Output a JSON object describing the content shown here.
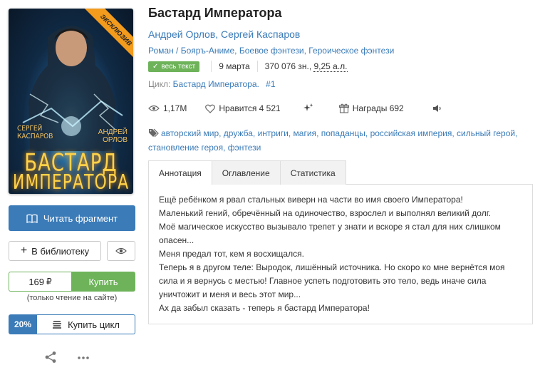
{
  "cover": {
    "ribbon": "ЭКСКЛЮЗИВ",
    "author_left": [
      "СЕРГЕЙ",
      "КАСПАРОВ"
    ],
    "author_right": [
      "АНДРЕЙ",
      "ОРЛОВ"
    ],
    "title_line1": "БАСТАРД",
    "title_line2": "ИМПЕРАТОРА"
  },
  "left": {
    "read_label": "Читать фрагмент",
    "library_label": "В библиотеку",
    "price": "169",
    "currency_icon": "ruble-icon",
    "buy_label": "Купить",
    "site_note": "(только чтение на сайте)",
    "cycle_discount": "20%",
    "cycle_buy_label": "Купить цикл"
  },
  "book": {
    "title": "Бастард Императора",
    "authors": "Андрей Орлов, Сергей Каспаров",
    "genres": "Роман / Бояръ-Аниме, Боевое фэнтези, Героическое фэнтези",
    "badge": "весь текст",
    "date": "9 марта",
    "size_prefix": "370 076 зн., ",
    "size_pages": "9,25 а.л.",
    "cycle_label": "Цикл:",
    "cycle_name": "Бастард Императора.",
    "cycle_num": "#1"
  },
  "stats": {
    "views": "1,17M",
    "likes": "Нравится 4 521",
    "awards": "Награды 692"
  },
  "tags": [
    "авторский мир",
    "дружба",
    "интриги",
    "магия",
    "попаданцы",
    "российская империя",
    "сильный герой",
    "становление героя",
    "фэнтези"
  ],
  "tabs": [
    "Аннотация",
    "Оглавление",
    "Статистика"
  ],
  "annotation": [
    "Ещё ребёнком я рвал стальных виверн на части во имя своего Императора!",
    "Маленький гений, обречённый на одиночество, взрослел и выполнял великий долг.",
    "Моё магическое искусство вызывало трепет у знати и вскоре я стал для них слишком опасен...",
    "Меня предал тот, кем я восхищался.",
    "Теперь я в другом теле: Выродок, лишённый источника. Но скоро ко мне вернётся моя сила и я вернусь с местью! Главное успеть подготовить это тело, ведь иначе сила уничтожит и меня и весь этот мир...",
    "Ах да забыл сказать - теперь я бастард Императора!"
  ],
  "colors": {
    "accent": "#3a7bb8",
    "buy": "#6eb35a",
    "ribbon": "#f29b1d"
  }
}
